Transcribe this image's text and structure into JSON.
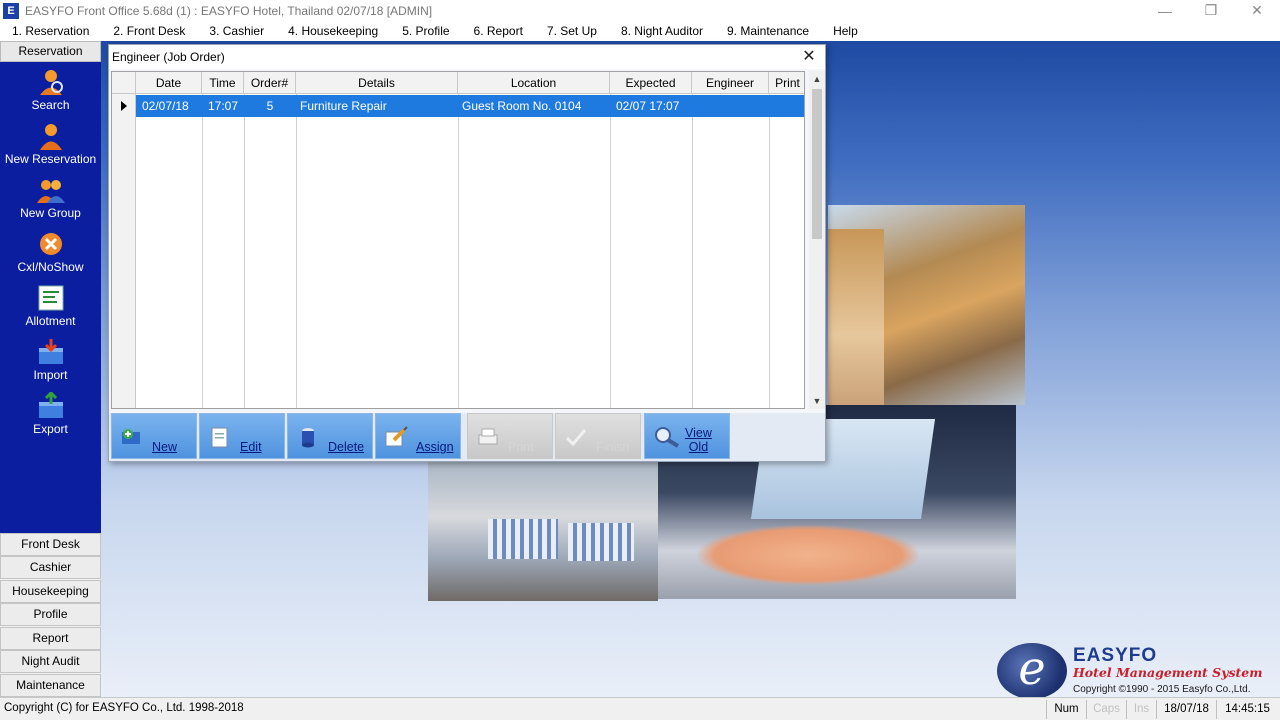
{
  "window": {
    "title": "EASYFO Front Office 5.68d (1) : EASYFO Hotel, Thailand  02/07/18 [ADMIN]",
    "app_icon_letter": "E"
  },
  "menu": [
    {
      "label": "1. Reservation"
    },
    {
      "label": "2. Front Desk"
    },
    {
      "label": "3. Cashier"
    },
    {
      "label": "4. Housekeeping"
    },
    {
      "label": "5. Profile"
    },
    {
      "label": "6. Report"
    },
    {
      "label": "7. Set Up"
    },
    {
      "label": "8. Night Auditor"
    },
    {
      "label": "9. Maintenance"
    },
    {
      "label": "Help"
    }
  ],
  "sidebar": {
    "header": "Reservation",
    "items": [
      {
        "label": "Search",
        "icon": "search-person-icon"
      },
      {
        "label": "New Reservation",
        "icon": "person-icon"
      },
      {
        "label": "New Group",
        "icon": "group-icon"
      },
      {
        "label": "Cxl/NoShow",
        "icon": "cancel-icon"
      },
      {
        "label": "Allotment",
        "icon": "list-icon"
      },
      {
        "label": "Import",
        "icon": "import-icon"
      },
      {
        "label": "Export",
        "icon": "export-icon"
      }
    ],
    "footer": [
      {
        "label": "Front Desk"
      },
      {
        "label": "Cashier"
      },
      {
        "label": "Housekeeping"
      },
      {
        "label": "Profile"
      },
      {
        "label": "Report"
      },
      {
        "label": "Night Audit"
      },
      {
        "label": "Maintenance"
      }
    ]
  },
  "dialog": {
    "title": "Engineer (Job Order)",
    "columns": [
      "Date",
      "Time",
      "Order#",
      "Details",
      "Location",
      "Expected",
      "Engineer",
      "Print"
    ],
    "rows": [
      {
        "date": "02/07/18",
        "time": "17:07",
        "order": "5",
        "details": "Furniture Repair",
        "location": "Guest Room No. 0104",
        "expected": "02/07 17:07",
        "engineer": "",
        "print": ""
      }
    ],
    "buttons": [
      {
        "label": "New",
        "icon": "new-icon",
        "enabled": true
      },
      {
        "label": "Edit",
        "icon": "edit-icon",
        "enabled": true
      },
      {
        "label": "Delete",
        "icon": "delete-icon",
        "enabled": true
      },
      {
        "label": "Assign",
        "icon": "assign-icon",
        "enabled": true
      },
      {
        "label": "Print",
        "icon": "print-icon",
        "enabled": false
      },
      {
        "label": "Finish",
        "icon": "checkmark-icon",
        "enabled": false
      },
      {
        "label_line1": "View",
        "label_line2": "Old",
        "icon": "view-icon",
        "enabled": true
      }
    ]
  },
  "logo": {
    "letter": "e",
    "brand": "EASYFO",
    "tagline": "Hotel Management System",
    "copyright": "Copyright ©1990 - 2015 Easyfo Co.,Ltd."
  },
  "statusbar": {
    "left": "Copyright (C) for EASYFO Co., Ltd. 1998-2018",
    "num": "Num",
    "caps": "Caps",
    "ins": "Ins",
    "date": "18/07/18",
    "time": "14:45:15"
  },
  "colors": {
    "sidebar_bg": "#0c1ea0",
    "selection": "#1f7ae0",
    "toolbar_button": "#5a9be3"
  }
}
